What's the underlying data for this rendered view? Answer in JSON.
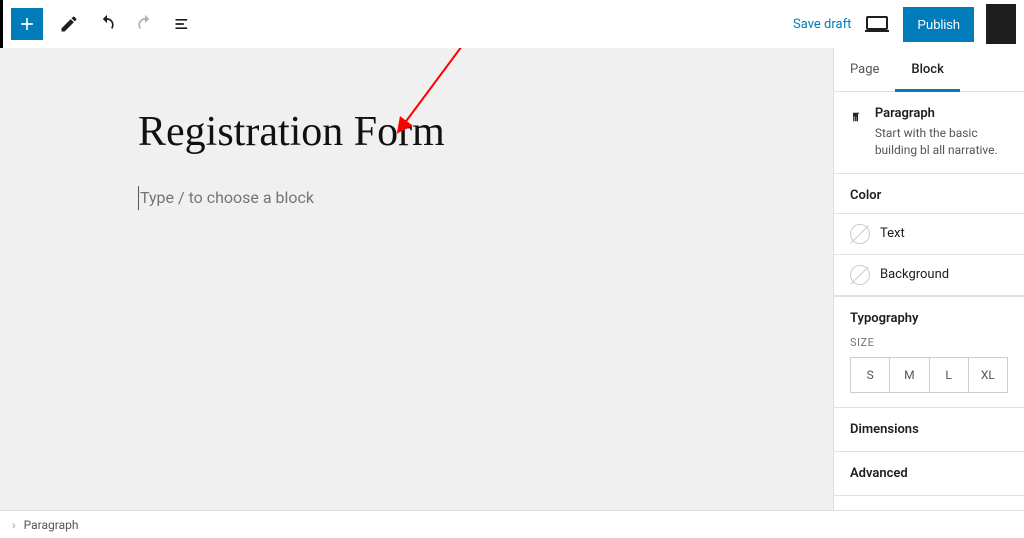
{
  "toolbar": {
    "save_draft": "Save draft",
    "publish": "Publish"
  },
  "editor": {
    "title": "Registration Form",
    "placeholder": "Type / to choose a block"
  },
  "sidebar": {
    "tabs": {
      "page": "Page",
      "block": "Block"
    },
    "block_name": "Paragraph",
    "block_desc": "Start with the basic building bl all narrative.",
    "color": {
      "heading": "Color",
      "text": "Text",
      "background": "Background"
    },
    "typography": {
      "heading": "Typography",
      "size_label": "SIZE",
      "sizes": [
        "S",
        "M",
        "L",
        "XL"
      ]
    },
    "dimensions": "Dimensions",
    "advanced": "Advanced"
  },
  "breadcrumb": {
    "item": "Paragraph"
  }
}
